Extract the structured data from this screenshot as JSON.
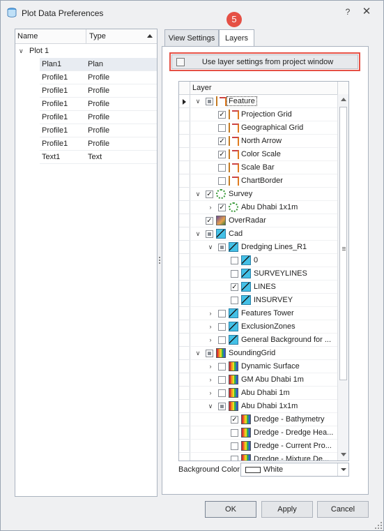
{
  "window": {
    "title": "Plot Data Preferences",
    "help_glyph": "?",
    "close_glyph": "✕"
  },
  "left_list": {
    "columns": {
      "name": "Name",
      "type": "Type"
    },
    "group": {
      "label": "Plot 1"
    },
    "rows": [
      {
        "name": "Plan1",
        "type": "Plan"
      },
      {
        "name": "Profile1",
        "type": "Profile"
      },
      {
        "name": "Profile1",
        "type": "Profile"
      },
      {
        "name": "Profile1",
        "type": "Profile"
      },
      {
        "name": "Profile1",
        "type": "Profile"
      },
      {
        "name": "Profile1",
        "type": "Profile"
      },
      {
        "name": "Profile1",
        "type": "Profile"
      },
      {
        "name": "Text1",
        "type": "Text"
      }
    ]
  },
  "tabs": [
    {
      "label": "View Settings"
    },
    {
      "label": "Layers"
    }
  ],
  "annotation_badge": "5",
  "use_layer_settings": {
    "label": "Use layer settings from project window",
    "checked": false
  },
  "layer_tree": {
    "column": "Layer",
    "rows": [
      {
        "label": "Feature",
        "icon": "feature-icon",
        "check": "partial",
        "expand": "open"
      },
      {
        "label": "Projection Grid",
        "icon": "feature-icon",
        "check": "checked",
        "expand": ""
      },
      {
        "label": "Geographical Grid",
        "icon": "feature-icon",
        "check": "unchecked",
        "expand": ""
      },
      {
        "label": "North Arrow",
        "icon": "feature-icon",
        "check": "checked",
        "expand": ""
      },
      {
        "label": "Color Scale",
        "icon": "feature-icon",
        "check": "checked",
        "expand": ""
      },
      {
        "label": "Scale Bar",
        "icon": "feature-icon",
        "check": "unchecked",
        "expand": ""
      },
      {
        "label": "ChartBorder",
        "icon": "feature-icon",
        "check": "unchecked",
        "expand": ""
      },
      {
        "label": "Survey",
        "icon": "survey-icon",
        "check": "checked",
        "expand": "open"
      },
      {
        "label": "Abu Dhabi 1x1m",
        "icon": "survey-icon",
        "check": "checked",
        "expand": "closed"
      },
      {
        "label": "OverRadar",
        "icon": "radar-icon",
        "check": "checked",
        "expand": ""
      },
      {
        "label": "Cad",
        "icon": "cad-icon",
        "check": "partial",
        "expand": "open"
      },
      {
        "label": "Dredging Lines_R1",
        "icon": "cad-icon",
        "check": "partial",
        "expand": "open"
      },
      {
        "label": "0",
        "icon": "cad-icon",
        "check": "unchecked",
        "expand": ""
      },
      {
        "label": "SURVEYLINES",
        "icon": "cad-icon",
        "check": "unchecked",
        "expand": ""
      },
      {
        "label": "LINES",
        "icon": "cad-icon",
        "check": "checked",
        "expand": ""
      },
      {
        "label": "INSURVEY",
        "icon": "cad-icon",
        "check": "unchecked",
        "expand": ""
      },
      {
        "label": "Features Tower",
        "icon": "cad-icon",
        "check": "unchecked",
        "expand": "closed"
      },
      {
        "label": "ExclusionZones",
        "icon": "cad-icon",
        "check": "unchecked",
        "expand": "closed"
      },
      {
        "label": "General Background for ...",
        "icon": "cad-icon",
        "check": "unchecked",
        "expand": "closed"
      },
      {
        "label": "SoundingGrid",
        "icon": "grid-icon",
        "check": "partial",
        "expand": "open"
      },
      {
        "label": "Dynamic Surface",
        "icon": "grid-icon",
        "check": "unchecked",
        "expand": "closed"
      },
      {
        "label": "GM Abu Dhabi 1m",
        "icon": "grid-icon",
        "check": "unchecked",
        "expand": "closed"
      },
      {
        "label": "Abu Dhabi 1m",
        "icon": "grid-icon",
        "check": "unchecked",
        "expand": "closed"
      },
      {
        "label": "Abu Dhabi 1x1m",
        "icon": "grid-icon",
        "check": "partial",
        "expand": "open"
      },
      {
        "label": "Dredge - Bathymetry",
        "icon": "grid-icon",
        "check": "checked",
        "expand": ""
      },
      {
        "label": "Dredge - Dredge Hea...",
        "icon": "grid-icon",
        "check": "unchecked",
        "expand": ""
      },
      {
        "label": "Dredge - Current Pro...",
        "icon": "grid-icon",
        "check": "unchecked",
        "expand": ""
      },
      {
        "label": "Dredge - Mixture De...",
        "icon": "grid-icon",
        "check": "unchecked",
        "expand": ""
      }
    ]
  },
  "background_color": {
    "label": "Background Color",
    "value": "White"
  },
  "buttons": {
    "ok": "OK",
    "apply": "Apply",
    "cancel": "Cancel"
  },
  "colors": {
    "accent_red": "#e55045",
    "window_bg": "#eff0f2",
    "border": "#aab3bf"
  }
}
